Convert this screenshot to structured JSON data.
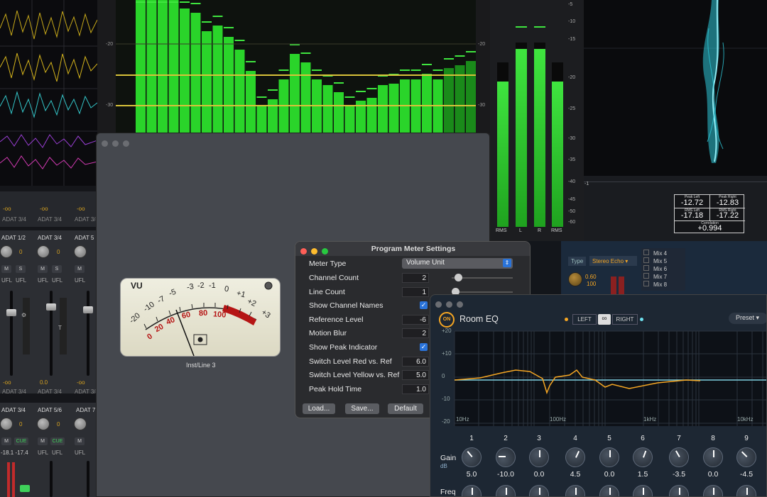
{
  "mixer": {
    "strips_row1": [
      "ADAT 1/2",
      "ADAT 3/4",
      "ADAT 5"
    ],
    "strips_row2": [
      "ADAT 3/4",
      "ADAT 5/6",
      "ADAT 7"
    ],
    "value_zero": "0",
    "neg_inf": "-oo",
    "zero_zero": "0.0",
    "btn_m": "M",
    "btn_s": "S",
    "btn_cue": "CUE",
    "ufl": "UFL",
    "adat34": "ADAT 3/4",
    "peak_vals": "-18.1 -17.4"
  },
  "spectrum": {
    "tick_minus20": "-20",
    "tick_minus30": "-30"
  },
  "level_meter": {
    "labels": [
      "RMS",
      "L",
      "R",
      "RMS"
    ],
    "scale": [
      "-5",
      "-10",
      "-15",
      "-20",
      "-25",
      "-30",
      "-35",
      "-40",
      "-45",
      "-50",
      "-60"
    ],
    "levels": [
      0.79,
      0.87,
      0.87,
      0.79
    ]
  },
  "correlation": {
    "axis_min": "-1",
    "peak_left_label": "Peak Left",
    "peak_right_label": "Peak Right",
    "peak_left": "-12.72",
    "peak_right": "-12.83",
    "rms_left_label": "RMS Left",
    "rms_right_label": "RMS Right",
    "rms_left": "-17.18",
    "rms_right": "-17.22",
    "corr_label": "Correlation",
    "corr_value": "+0.994"
  },
  "echo_plugin": {
    "type_label": "Type",
    "type_value": "Stereo Echo",
    "knob_val1": "0.60",
    "knob_val2": "100",
    "mix_items": [
      "Mix 4",
      "Mix 5",
      "Mix 6",
      "Mix 7",
      "Mix 8"
    ]
  },
  "vu_meter": {
    "title": "VU",
    "upper_scale": [
      "-20",
      "-10",
      "-7",
      "-5",
      "-3",
      "-2",
      "-1",
      "0",
      "+1",
      "+2",
      "+3"
    ],
    "lower_scale": [
      "0",
      "20",
      "40",
      "60",
      "80",
      "100"
    ],
    "channel_label": "Inst/Line 3"
  },
  "settings": {
    "title": "Program Meter Settings",
    "meter_type_label": "Meter Type",
    "meter_type_value": "Volume Unit",
    "rows": [
      {
        "label": "Channel Count",
        "value": "2",
        "kind": "num_slider"
      },
      {
        "label": "Line Count",
        "value": "1",
        "kind": "num_slider"
      },
      {
        "label": "Show Channel Names",
        "value": "✓",
        "kind": "check"
      },
      {
        "label": "Reference Level",
        "value": "-6",
        "kind": "num"
      },
      {
        "label": "Motion Blur",
        "value": "2",
        "kind": "num"
      },
      {
        "label": "Show Peak Indicator",
        "value": "✓",
        "kind": "check"
      },
      {
        "label": "Switch Level Red vs. Ref",
        "value": "6.0",
        "kind": "num"
      },
      {
        "label": "Switch Level Yellow vs. Ref",
        "value": "5.0",
        "kind": "num"
      },
      {
        "label": "Peak Hold Time",
        "value": "1.0",
        "kind": "num"
      }
    ],
    "load_label": "Load...",
    "save_label": "Save...",
    "default_label": "Default"
  },
  "eq": {
    "on_label": "ON",
    "title": "Room EQ",
    "left_label": "LEFT",
    "right_label": "RIGHT",
    "preset_label": "Preset",
    "y_ticks": [
      "+20",
      "+10",
      "0",
      "-10",
      "-20"
    ],
    "x_ticks": [
      "10Hz",
      "100Hz",
      "1kHz",
      "10kHz"
    ],
    "bands": [
      "1",
      "2",
      "3",
      "4",
      "5",
      "6",
      "7",
      "8",
      "9"
    ],
    "gain_label": "Gain",
    "db_label": "dB",
    "gains": [
      "5.0",
      "-10.0",
      "0.0",
      "4.5",
      "0.0",
      "1.5",
      "-3.5",
      "0.0",
      "-4.5"
    ],
    "freq_label": "Freq"
  },
  "colors": {
    "accent_orange": "#f5a623",
    "meter_green": "#22d422",
    "meter_red": "#b51515",
    "scope_cyan": "#2ec8d8"
  }
}
